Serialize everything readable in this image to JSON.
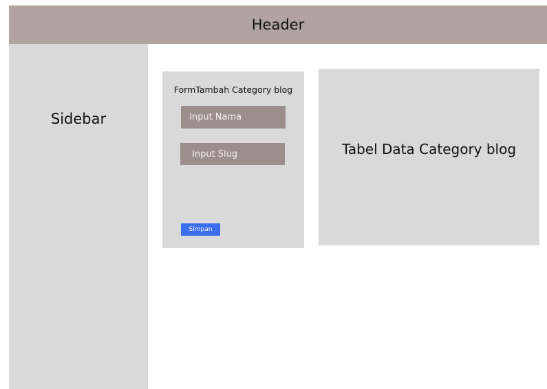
{
  "header": {
    "title": "Header"
  },
  "sidebar": {
    "label": "Sidebar"
  },
  "form": {
    "title": "FormTambah Category blog",
    "nama_input_text": "Input Nama",
    "slug_input_text": "Input Slug",
    "save_label": "Simpan"
  },
  "table": {
    "label": "Tabel Data Category blog"
  },
  "colors": {
    "header_bg": "#b1a3a1",
    "panel_bg": "#d9d9d9",
    "input_bg": "#9b8e8c",
    "button_bg": "#3b6ded"
  }
}
